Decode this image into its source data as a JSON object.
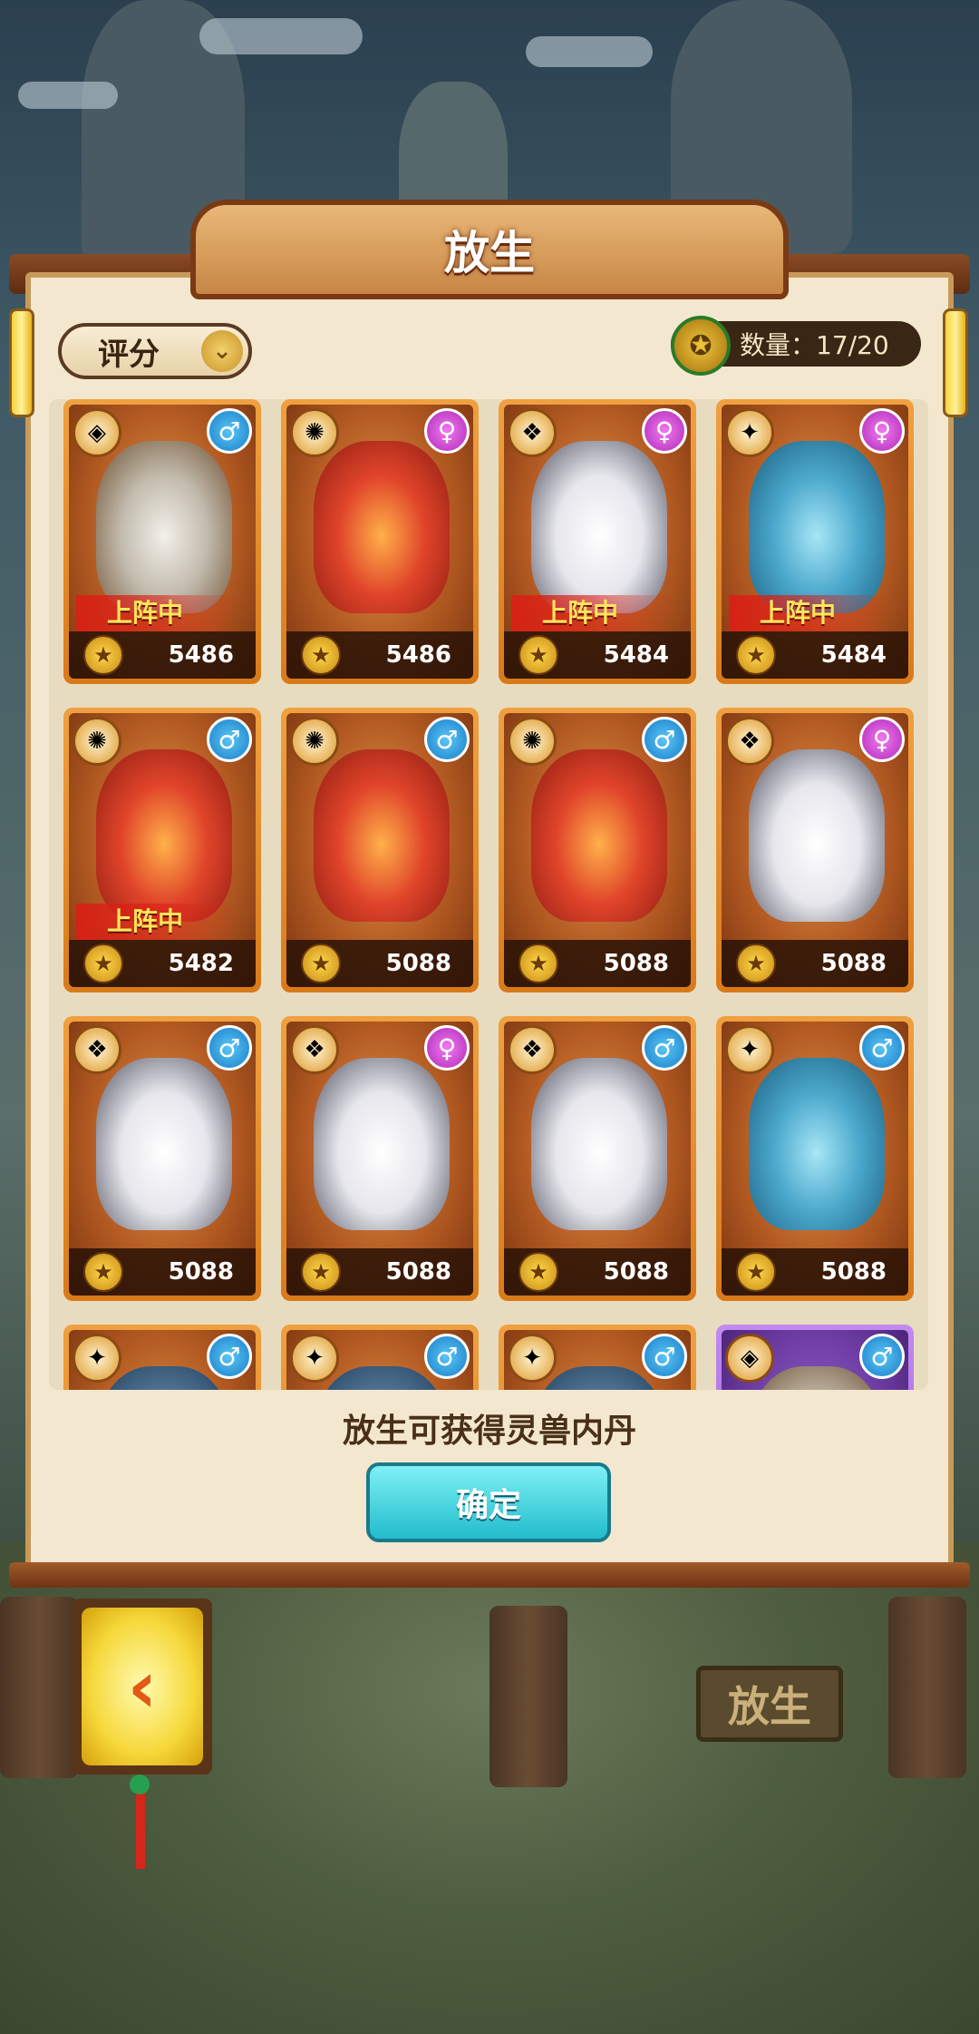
{
  "title": "放生",
  "sort": {
    "label": "评分",
    "arrow_icon": "double-chevron-down-icon"
  },
  "count": {
    "label": "数量：17/20"
  },
  "cards": [
    {
      "element": "qilin",
      "gender": "male",
      "power": "5486",
      "on_team": true
    },
    {
      "element": "phoenix",
      "gender": "female",
      "power": "5486",
      "on_team": false
    },
    {
      "element": "tiger",
      "gender": "female",
      "power": "5484",
      "on_team": true
    },
    {
      "element": "dragon",
      "gender": "female",
      "power": "5484",
      "on_team": true
    },
    {
      "element": "phoenix",
      "gender": "male",
      "power": "5482",
      "on_team": true
    },
    {
      "element": "phoenix",
      "gender": "male",
      "power": "5088",
      "on_team": false
    },
    {
      "element": "phoenix",
      "gender": "male",
      "power": "5088",
      "on_team": false
    },
    {
      "element": "tiger",
      "gender": "female",
      "power": "5088",
      "on_team": false
    },
    {
      "element": "tiger",
      "gender": "male",
      "power": "5088",
      "on_team": false
    },
    {
      "element": "tiger",
      "gender": "female",
      "power": "5088",
      "on_team": false
    },
    {
      "element": "tiger",
      "gender": "male",
      "power": "5088",
      "on_team": false
    },
    {
      "element": "dragon",
      "gender": "male",
      "power": "5088",
      "on_team": false
    },
    {
      "element": "dragon-dark",
      "gender": "male",
      "power": "",
      "on_team": false
    },
    {
      "element": "dragon-dark",
      "gender": "male",
      "power": "",
      "on_team": false
    },
    {
      "element": "dragon-dark",
      "gender": "male",
      "power": "",
      "on_team": false
    },
    {
      "element": "qilin",
      "gender": "male",
      "power": "",
      "on_team": false,
      "rarity": "purple"
    }
  ],
  "on_team_label": "上阵中",
  "hint": "放生可获得灵兽内丹",
  "confirm_label": "确定",
  "back_icon": "back-arrow-icon",
  "sign_label": "放生"
}
